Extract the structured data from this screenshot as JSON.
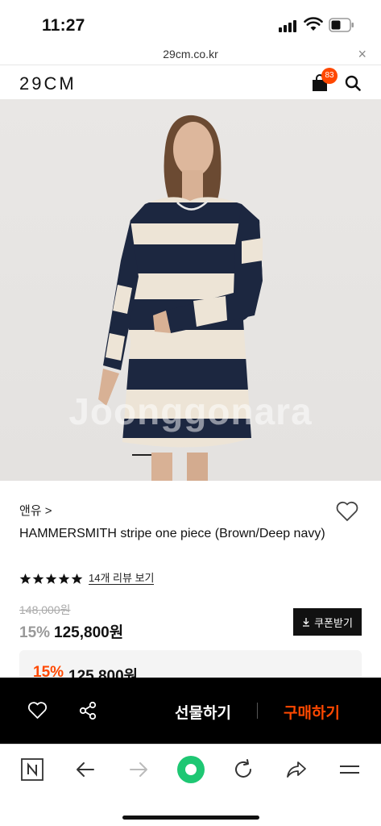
{
  "status_bar": {
    "time": "11:27"
  },
  "browser": {
    "url": "29cm.co.kr",
    "close_label": "×"
  },
  "header": {
    "logo": "29CM",
    "cart_count": "83"
  },
  "image": {
    "watermark": "Joonggonara"
  },
  "product": {
    "brand": "앤유 >",
    "name": "HAMMERSMITH stripe one piece (Brown/Deep navy)",
    "rating": 5,
    "review_link": "14개 리뷰 보기",
    "original_price": "148,000원",
    "discount_rate": "15%",
    "price": "125,800원",
    "coupon_label": "쿠폰받기"
  },
  "promo": {
    "rate": "15%",
    "price": "125,800원"
  },
  "actions": {
    "gift_label": "선물하기",
    "buy_label": "구매하기"
  },
  "colors": {
    "accent": "#ff4800",
    "toggle_green": "#1ec773"
  }
}
